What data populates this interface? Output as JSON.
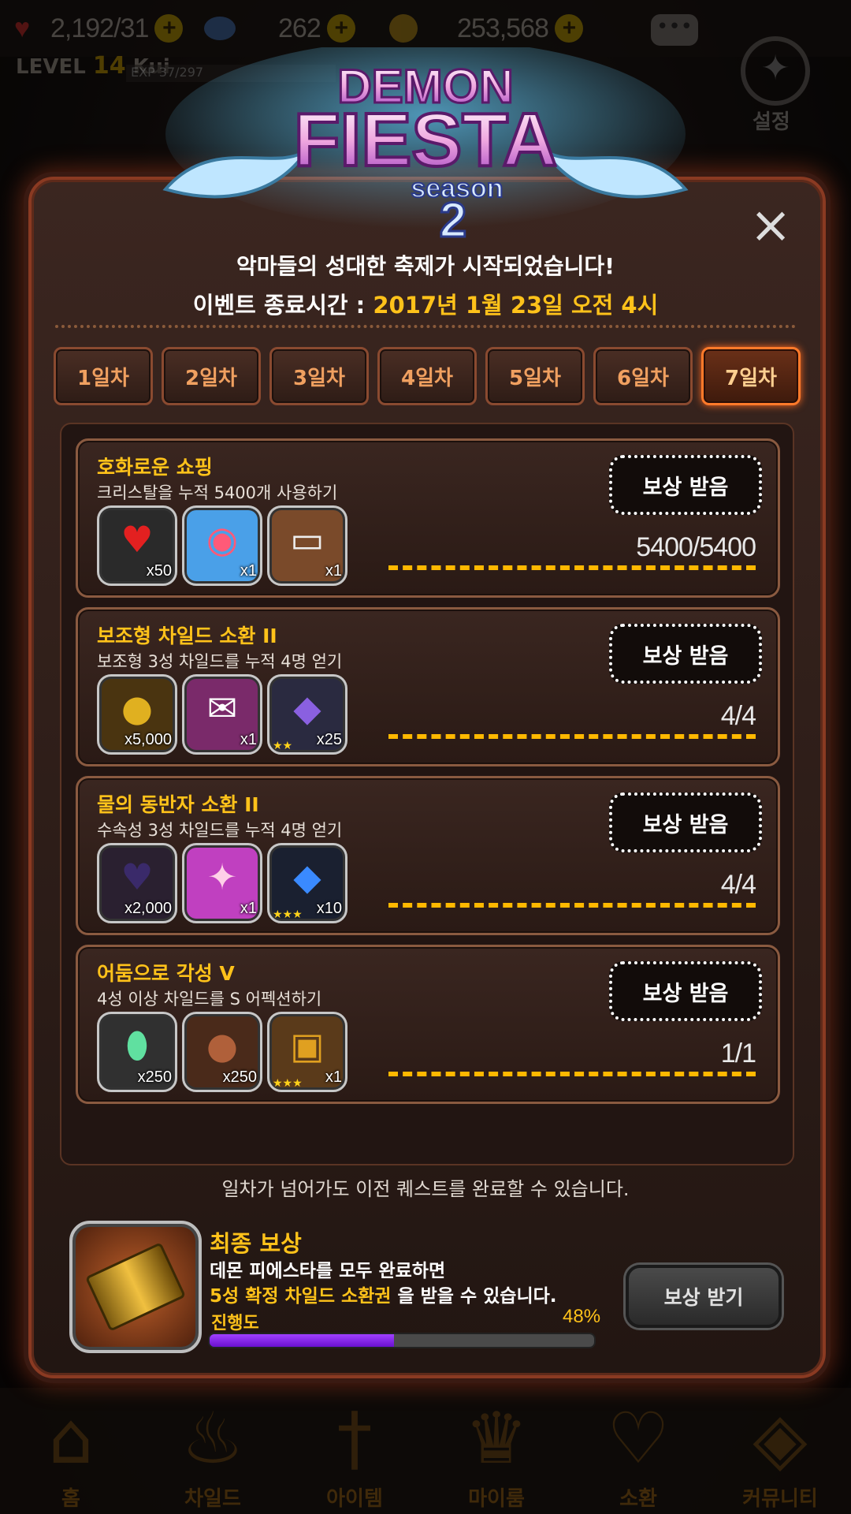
{
  "hud": {
    "hearts": "2,192/31",
    "gems": "262",
    "gold": "253,568",
    "level_prefix": "LEVEL",
    "level": "14",
    "player": "Kui",
    "exp": "EXP 37/297",
    "settings_label": "설정"
  },
  "event": {
    "logo": {
      "line1": "DEMON",
      "line2": "FIESTA",
      "line3": "season",
      "line4": "2"
    },
    "headline": "악마들의 성대한 축제가 시작되었습니다!",
    "end_prefix": "이벤트 종료시간 : ",
    "end_date": "2017년 1월 23일 오전 4시",
    "close_glyph": "×"
  },
  "tabs": [
    {
      "label": "1일차",
      "active": false
    },
    {
      "label": "2일차",
      "active": false
    },
    {
      "label": "3일차",
      "active": false
    },
    {
      "label": "4일차",
      "active": false
    },
    {
      "label": "5일차",
      "active": false
    },
    {
      "label": "6일차",
      "active": false
    },
    {
      "label": "7일차",
      "active": true
    }
  ],
  "quests": [
    {
      "title": "호화로운 쇼핑",
      "desc": "크리스탈을 누적 5400개 사용하기",
      "claim": "보상 받음",
      "progress": "5400/5400",
      "items": [
        {
          "icon": "heart-icon",
          "glyph": "♥",
          "color": "#e32020",
          "bg": "#2a2a2a",
          "count": "x50",
          "stars": ""
        },
        {
          "icon": "gift-box-icon",
          "glyph": "◉",
          "color": "#ff5a78",
          "bg": "#4aa0e8",
          "count": "x1",
          "stars": ""
        },
        {
          "icon": "card-icon",
          "glyph": "▭",
          "color": "#eeeeee",
          "bg": "#7a4a2a",
          "count": "x1",
          "stars": ""
        }
      ]
    },
    {
      "title": "보조형 차일드 소환 II",
      "desc": "보조형 3성 차일드를 누적 4명 얻기",
      "claim": "보상 받음",
      "progress": "4/4",
      "items": [
        {
          "icon": "gold-coins-icon",
          "glyph": "●",
          "color": "#e0b020",
          "bg": "#4a3410",
          "count": "x5,000",
          "stars": ""
        },
        {
          "icon": "summon-ticket-icon",
          "glyph": "✉",
          "color": "#ffffff",
          "bg": "#7a2a6a",
          "count": "x1",
          "stars": ""
        },
        {
          "icon": "crystal-icon",
          "glyph": "◆",
          "color": "#8a60e0",
          "bg": "#2a2a40",
          "count": "x25",
          "stars": "★★"
        }
      ]
    },
    {
      "title": "물의 동반자 소환 II",
      "desc": "수속성 3성 차일드를 누적 4명 얻기",
      "claim": "보상 받음",
      "progress": "4/4",
      "items": [
        {
          "icon": "dark-heart-icon",
          "glyph": "♥",
          "color": "#3a2a6a",
          "bg": "#2a2030",
          "count": "x2,000",
          "stars": ""
        },
        {
          "icon": "ticket-icon",
          "glyph": "✦",
          "color": "#ffd0e8",
          "bg": "#c040c0",
          "count": "x1",
          "stars": ""
        },
        {
          "icon": "blue-gem-icon",
          "glyph": "◆",
          "color": "#3a8aff",
          "bg": "#1a2030",
          "count": "x10",
          "stars": "★★★"
        }
      ]
    },
    {
      "title": "어둠으로 각성 V",
      "desc": "4성 이상 차일드를 S 어펙션하기",
      "claim": "보상 받음",
      "progress": "1/1",
      "items": [
        {
          "icon": "rainbow-gem-icon",
          "glyph": "⬮",
          "color": "#60e0a0",
          "bg": "#303030",
          "count": "x250",
          "stars": ""
        },
        {
          "icon": "copper-coin-icon",
          "glyph": "●",
          "color": "#b0603a",
          "bg": "#4a2a1a",
          "count": "x250",
          "stars": ""
        },
        {
          "icon": "treasure-chest-icon",
          "glyph": "▣",
          "color": "#e0a020",
          "bg": "#5a3a1a",
          "count": "x1",
          "stars": "★★★"
        }
      ]
    }
  ],
  "note": "일차가 넘어가도 이전 퀘스트를 완료할 수 있습니다.",
  "final": {
    "title": "최종 보상",
    "line1": "데몬 피에스타를 모두 완료하면",
    "line2_highlight": "5성 확정 차일드 소환권",
    "line2_rest": " 을 받을 수 있습니다.",
    "progress_label": "진행도",
    "progress_pct": "48%",
    "progress_value": 0.48,
    "button": "보상 받기"
  },
  "nav": [
    {
      "label": "홈",
      "icon": "home-icon",
      "glyph": "⌂"
    },
    {
      "label": "차일드",
      "icon": "flame-icon",
      "glyph": "♨"
    },
    {
      "label": "아이템",
      "icon": "sword-icon",
      "glyph": "†"
    },
    {
      "label": "마이룸",
      "icon": "crown-icon",
      "glyph": "♛"
    },
    {
      "label": "소환",
      "icon": "potion-icon",
      "glyph": "♡"
    },
    {
      "label": "커뮤니티",
      "icon": "shield-icon",
      "glyph": "◈"
    }
  ]
}
